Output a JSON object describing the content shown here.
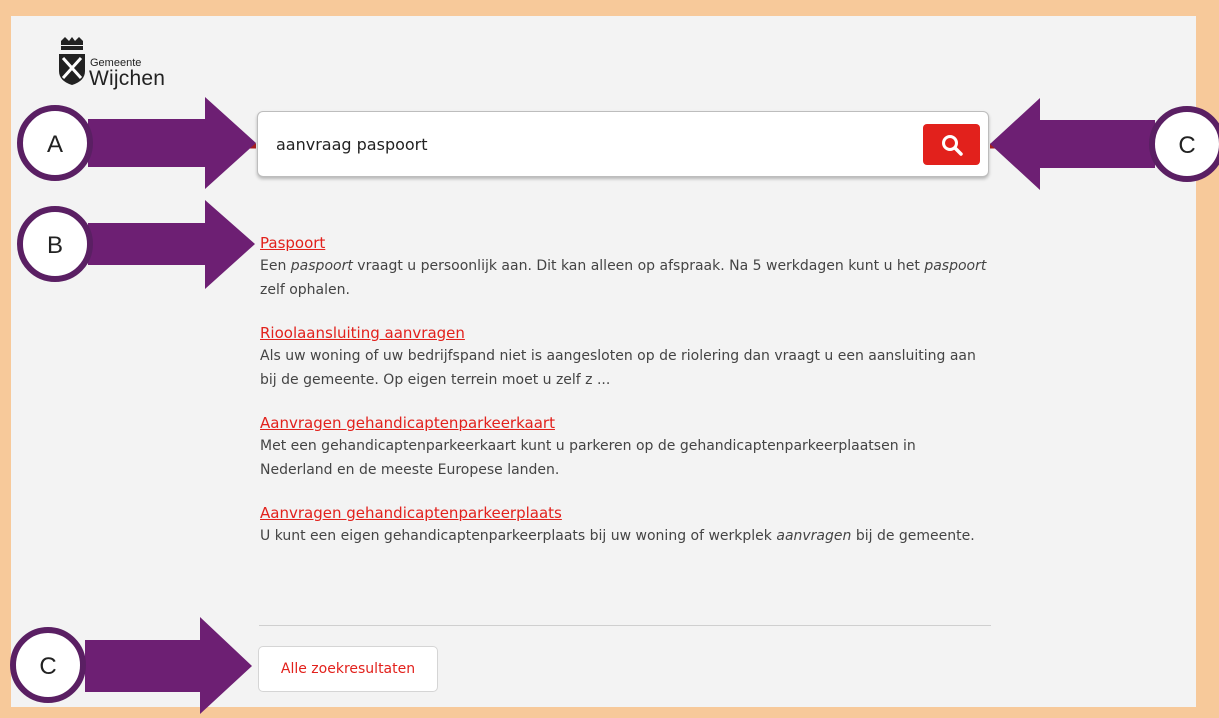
{
  "header": {
    "logo_small": "Gemeente",
    "logo_big": "Wijchen"
  },
  "search": {
    "value": "aanvraag paspoort",
    "button_icon": "search-icon"
  },
  "results": [
    {
      "title": "Paspoort",
      "description": [
        {
          "text": "Een "
        },
        {
          "text": "paspoort",
          "italic": true
        },
        {
          "text": " vraagt u persoonlijk aan. Dit kan alleen op afspraak. Na 5 werkdagen kunt u het "
        },
        {
          "text": "paspoort",
          "italic": true
        },
        {
          "text": " zelf ophalen."
        }
      ]
    },
    {
      "title": "Rioolaansluiting aanvragen",
      "description": [
        {
          "text": "Als uw woning of uw bedrijfspand niet is aangesloten op de riolering dan vraagt u een aansluiting aan bij de gemeente. Op eigen terrein moet u zelf z ..."
        }
      ]
    },
    {
      "title": "Aanvragen gehandicaptenparkeerkaart",
      "description": [
        {
          "text": "Met een gehandicaptenparkeerkaart kunt u parkeren op de gehandicaptenparkeerplaatsen in Nederland en de meeste Europese landen."
        }
      ]
    },
    {
      "title": "Aanvragen gehandicaptenparkeerplaats",
      "description": [
        {
          "text": "U kunt een eigen gehandicaptenparkeerplaats bij uw woning of werkplek "
        },
        {
          "text": "aanvragen",
          "italic": true
        },
        {
          "text": " bij de gemeente."
        }
      ]
    }
  ],
  "all_results_label": "Alle zoekresultaten",
  "annotations": {
    "labels": [
      "A",
      "B",
      "C",
      "C"
    ],
    "circle_border": "#5a1f63",
    "arrow_fill": "#6d1f73",
    "connector": "#a51d1d"
  },
  "colors": {
    "accent": "#e2211c",
    "frame": "#f7c99a",
    "panel": "#f3f3f3"
  }
}
